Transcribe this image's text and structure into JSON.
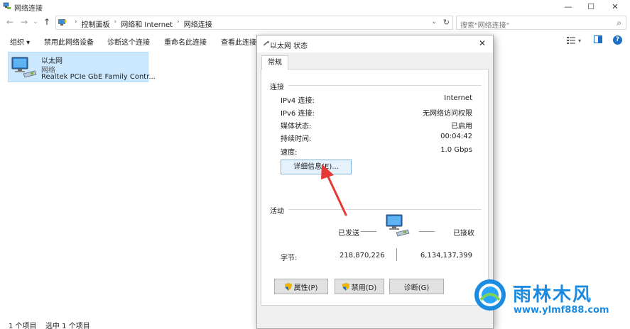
{
  "explorer": {
    "title": "网络连接",
    "search_placeholder": "搜索\"网络连接\"",
    "breadcrumbs": [
      "控制面板",
      "网络和 Internet",
      "网络连接"
    ],
    "commands": [
      "组织 ▾",
      "禁用此网络设备",
      "诊断这个连接",
      "重命名此连接",
      "查看此连接"
    ],
    "adapter": {
      "name": "以太网",
      "network": "网络",
      "device": "Realtek PCIe GbE Family Contr..."
    },
    "status": {
      "item_count": "1 个项目",
      "selected": "选中 1 个项目"
    }
  },
  "dialog": {
    "title": "以太网 状态",
    "tab": "常规",
    "connection_heading": "连接",
    "rows": [
      {
        "label": "IPv4 连接:",
        "value": "Internet"
      },
      {
        "label": "IPv6 连接:",
        "value": "无网络访问权限"
      },
      {
        "label": "媒体状态:",
        "value": "已启用"
      },
      {
        "label": "持续时间:",
        "value": "00:04:42"
      },
      {
        "label": "速度:",
        "value": "1.0 Gbps"
      }
    ],
    "details_button": "详细信息(E)...",
    "activity_heading": "活动",
    "sent_label": "已发送",
    "received_label": "已接收",
    "bytes_label": "字节:",
    "bytes_sent": "218,870,226",
    "bytes_received": "6,134,137,399",
    "buttons": {
      "properties": "属性(P)",
      "disable": "禁用(D)",
      "diagnose": "诊断(G)"
    }
  },
  "watermark": {
    "title": "雨林木风",
    "url": "www.ylmf888.com"
  },
  "colors": {
    "selection": "#cce8ff",
    "accent": "#1f6fc5",
    "arrow": "#e53935",
    "watermark": "#1a8be0"
  }
}
